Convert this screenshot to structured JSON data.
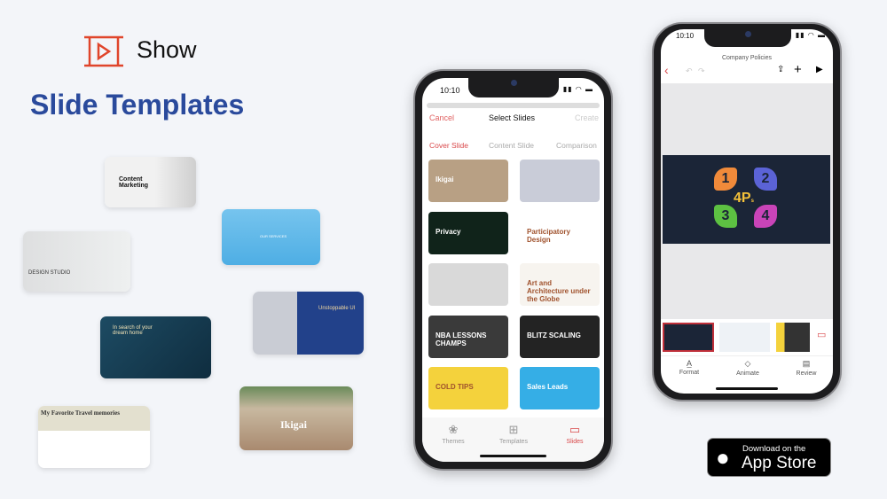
{
  "brand": {
    "name": "Show",
    "logo": "show-play-icon",
    "accent": "#e0452b"
  },
  "headline": "Slide Templates",
  "floating_templates": [
    {
      "title": "Content Marketing",
      "color": "#eeeeee"
    },
    {
      "title": "OUR SERVICES",
      "color": "#5eb6e8"
    },
    {
      "title": "DESIGN STUDIO",
      "color": "#e4e5e6"
    },
    {
      "title": "Unstoppable UI",
      "color": "#22418a"
    },
    {
      "title": "In search of your dream home",
      "color": "#1d4b63"
    },
    {
      "title": "Ikigai",
      "color": "#b99b7f"
    },
    {
      "title": "My Favorite Travel memories",
      "color": "#e3e0cf"
    }
  ],
  "phone_left": {
    "time": "10:10",
    "header": {
      "cancel": "Cancel",
      "title": "Select Slides",
      "create": "Create"
    },
    "tabs": [
      "Cover Slide",
      "Content Slide",
      "Comparison"
    ],
    "slides": [
      {
        "title": "Ikigai",
        "color": "#b8a084"
      },
      {
        "title": "",
        "color": "#c9ccd8"
      },
      {
        "title": "Privacy",
        "color": "#10231a"
      },
      {
        "title": "Participatory Design",
        "color": "#ffffff"
      },
      {
        "title": "",
        "color": "#d9d9d9"
      },
      {
        "title": "Art and Architecture under the Globe",
        "color": "#f7f4ef"
      },
      {
        "title": "NBA LESSONS CHAMPS",
        "color": "#3a3a3a"
      },
      {
        "title": "BLITZ SCALING",
        "color": "#232323"
      },
      {
        "title": "COLD TIPS",
        "color": "#f4d23c"
      },
      {
        "title": "Sales Leads",
        "color": "#35aee6"
      }
    ],
    "bottom_tabs": [
      {
        "label": "Themes",
        "icon": "themes-icon"
      },
      {
        "label": "Templates",
        "icon": "templates-icon"
      },
      {
        "label": "Slides",
        "icon": "slides-icon",
        "active": true
      }
    ]
  },
  "phone_right": {
    "time": "10:10",
    "title": "Company Policies",
    "slide": {
      "title": "4P",
      "suffix": "s",
      "numbers": [
        "1",
        "2",
        "3",
        "4"
      ],
      "colors": [
        "#f08a3a",
        "#5b63d6",
        "#5dc142",
        "#c944b8"
      ],
      "bg": "#1b2537"
    },
    "bottom_tabs": [
      {
        "label": "Format",
        "icon": "format-icon"
      },
      {
        "label": "Animate",
        "icon": "animate-icon"
      },
      {
        "label": "Review",
        "icon": "review-icon"
      }
    ]
  },
  "app_store": {
    "line1": "Download on the",
    "line2": "App Store"
  }
}
